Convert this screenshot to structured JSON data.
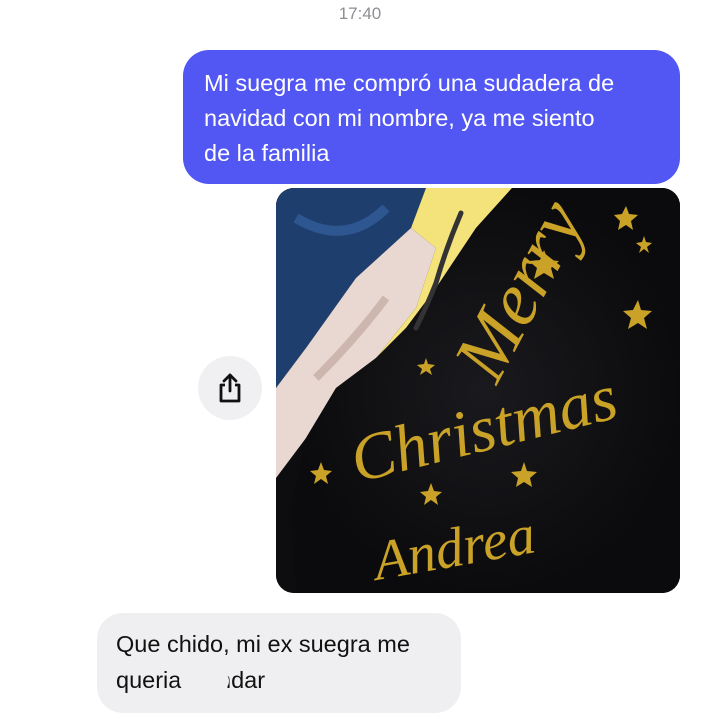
{
  "status": {
    "time": "17:40"
  },
  "messages": [
    {
      "direction": "outgoing",
      "type": "text",
      "text": "Mi suegra me compró una sudadera de navidad con mi nombre, ya me siento de la familia",
      "lines": [
        "Mi suegra me compró una sudadera de",
        "navidad con mi nombre, ya me siento",
        "de la familia"
      ],
      "color": "#5256f2"
    },
    {
      "direction": "outgoing",
      "type": "image",
      "printed_text": [
        "Merry",
        "Christmas",
        "Andrea"
      ],
      "text_color": "#c9a227"
    },
    {
      "direction": "incoming",
      "type": "text",
      "lines": [
        "Que chido, mi ex suegra me",
        "queria d",
        "andar"
      ],
      "color": "#efeff1"
    }
  ],
  "icons": {
    "share": "share-icon"
  }
}
